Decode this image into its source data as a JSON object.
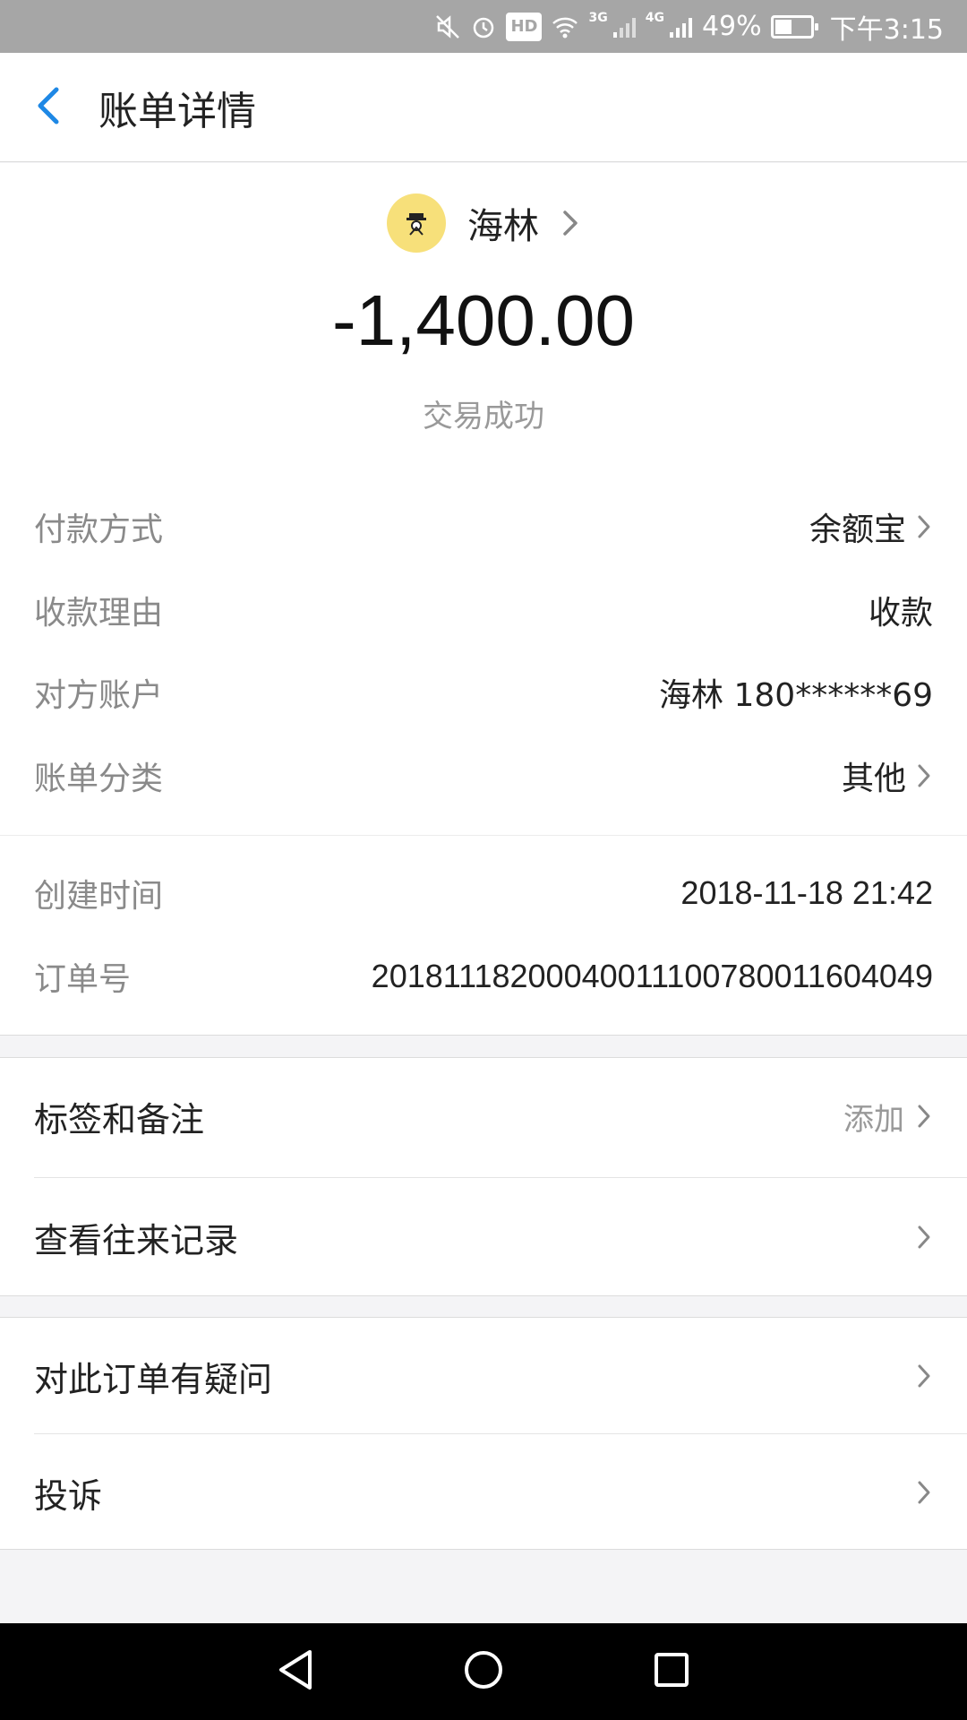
{
  "status_bar": {
    "hd_label": "HD",
    "net_3g": "3G",
    "net_4g": "4G",
    "battery_percent": "49%",
    "time": "下午3:15",
    "icons": [
      "mute-icon",
      "alarm-icon",
      "hd-icon",
      "wifi-icon",
      "signal-icon",
      "battery-icon"
    ]
  },
  "header": {
    "back_icon": "back-arrow-icon",
    "title": "账单详情",
    "accent_color": "#1e88e5"
  },
  "summary": {
    "payee_name": "海林",
    "amount": "-1,400.00",
    "status": "交易成功"
  },
  "details": [
    {
      "label": "付款方式",
      "value": "余额宝",
      "has_chevron": true
    },
    {
      "label": "收款理由",
      "value": "收款",
      "has_chevron": false
    },
    {
      "label": "对方账户",
      "value": "海林 180******69",
      "has_chevron": false
    },
    {
      "label": "账单分类",
      "value": "其他",
      "has_chevron": true
    }
  ],
  "meta": [
    {
      "label": "创建时间",
      "value": "2018-11-18 21:42"
    },
    {
      "label": "订单号",
      "value": "20181118200040011100780011604049"
    }
  ],
  "actions_1": [
    {
      "label": "标签和备注",
      "hint": "添加"
    },
    {
      "label": "查看往来记录",
      "hint": ""
    }
  ],
  "actions_2": [
    {
      "label": "对此订单有疑问"
    },
    {
      "label": "投诉"
    }
  ],
  "nav": [
    "back-triangle-icon",
    "home-circle-icon",
    "recents-square-icon"
  ]
}
